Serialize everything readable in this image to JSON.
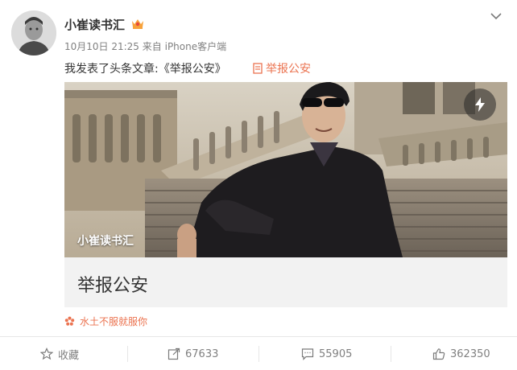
{
  "post": {
    "author": "小崔读书汇",
    "time": "10月10日 21:25",
    "source_prefix": "来自",
    "client": "iPhone客户端",
    "text": "我发表了头条文章:《举报公安》",
    "article_link": "举报公安"
  },
  "article_card": {
    "image_caption": "小崔读书汇",
    "title": "举报公安"
  },
  "source_note": "水土不服就服你",
  "actions": {
    "favorite_label": "收藏",
    "repost_count": "67633",
    "comment_count": "55905",
    "like_count": "362350"
  },
  "colors": {
    "accent": "#eb7350",
    "muted_text": "#808080",
    "card_bg": "#f2f2f2"
  }
}
